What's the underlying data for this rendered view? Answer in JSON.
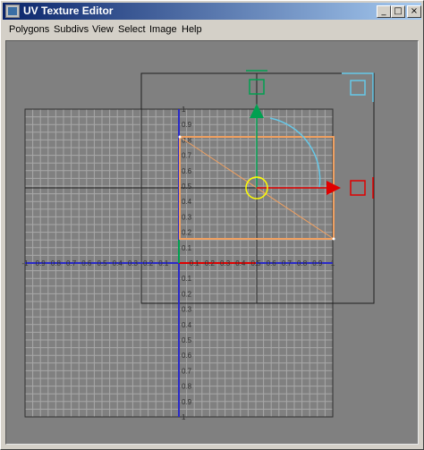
{
  "window": {
    "title": "UV Texture Editor",
    "buttons": {
      "minimize": "_",
      "maximize": "□",
      "close": "×"
    }
  },
  "menu": [
    "Polygons",
    "Subdivs",
    "View",
    "Select",
    "Image",
    "Help"
  ],
  "axes": {
    "x_neg_labels": [
      "-1",
      "0.9",
      "0.8",
      "0.7",
      "0.6",
      "0.5",
      "0.4",
      "0.3",
      "0.2",
      "0.1"
    ],
    "x_pos_labels": [
      "0.1",
      "0.2",
      "0.3",
      "0.4",
      "0.5",
      "0.6",
      "0.7",
      "0.8",
      "0.9",
      "1"
    ],
    "y_pos_labels": [
      "1",
      "0.9",
      "0.8",
      "0.7",
      "0.6",
      "0.5",
      "0.4",
      "0.3",
      "0.2",
      "0.1"
    ],
    "y_neg_labels": [
      "0.1",
      "0.2",
      "0.3",
      "0.4",
      "0.5",
      "0.6",
      "0.7",
      "0.8",
      "0.9",
      "1"
    ]
  },
  "colors": {
    "grid": "#a8a8a8",
    "axis_blue": "#2a2ac8",
    "u_axis_red": "#e00000",
    "v_axis_green": "#00a050",
    "selection_orange": "#f0a060",
    "rotate_cyan": "#66c8e8",
    "pivot_yellow": "#ffff00",
    "frame": "#202020"
  },
  "icons": {
    "move_up": "green-arrow-up-icon",
    "move_right": "red-arrow-right-icon",
    "scale_u": "red-square-handle-icon",
    "scale_v": "green-square-handle-icon",
    "scale_uv": "cyan-square-handle-icon",
    "pivot": "yellow-circle-pivot-icon"
  }
}
